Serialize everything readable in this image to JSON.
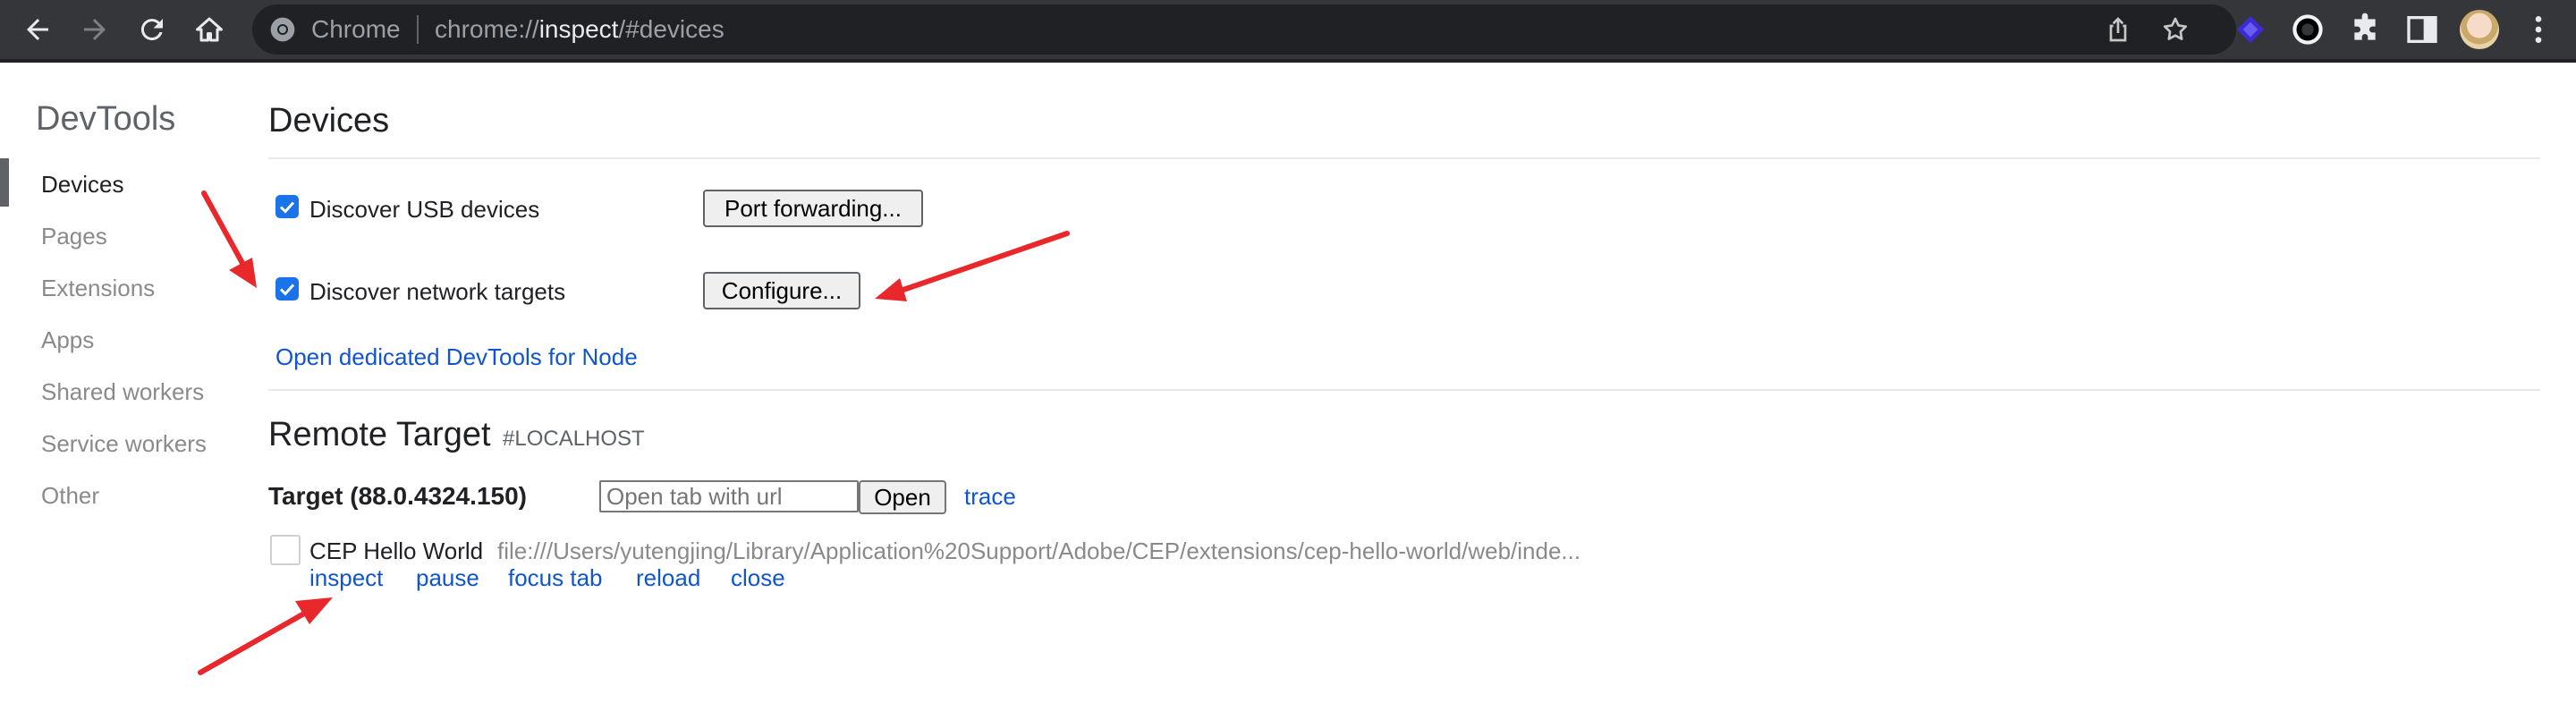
{
  "browser": {
    "site_chip": "Chrome",
    "url_scheme": "chrome://",
    "url_host": "inspect",
    "url_path": "/#devices",
    "toolbar_icons": [
      "back-icon",
      "forward-icon",
      "reload-icon",
      "home-icon",
      "share-icon",
      "bookmark-star-icon",
      "extension-purple-icon",
      "extension-ring-icon",
      "puzzle-icon",
      "side-panel-icon",
      "profile-avatar",
      "more-icon"
    ]
  },
  "sidebar": {
    "title": "DevTools",
    "items": [
      {
        "label": "Devices",
        "selected": true
      },
      {
        "label": "Pages"
      },
      {
        "label": "Extensions"
      },
      {
        "label": "Apps"
      },
      {
        "label": "Shared workers"
      },
      {
        "label": "Service workers"
      },
      {
        "label": "Other"
      }
    ]
  },
  "devices": {
    "heading": "Devices",
    "usb": {
      "label": "Discover USB devices",
      "checked": true,
      "button": "Port forwarding..."
    },
    "network": {
      "label": "Discover network targets",
      "checked": true,
      "button": "Configure..."
    },
    "node_link": "Open dedicated DevTools for Node"
  },
  "remote": {
    "heading": "Remote Target",
    "subheading": "#LOCALHOST",
    "target_title": "Target (88.0.4324.150)",
    "open_placeholder": "Open tab with url",
    "open_button": "Open",
    "trace_link": "trace",
    "page": {
      "name": "CEP Hello World",
      "url": "file:///Users/yutengjing/Library/Application%20Support/Adobe/CEP/extensions/cep-hello-world/web/inde...",
      "actions": [
        "inspect",
        "pause",
        "focus tab",
        "reload",
        "close"
      ]
    }
  },
  "colors": {
    "toolbar_bg": "#35363a",
    "omnibox_bg": "#202124",
    "link": "#1155cc",
    "checkbox": "#1a73e8",
    "annotation_arrow": "#e8282b"
  }
}
